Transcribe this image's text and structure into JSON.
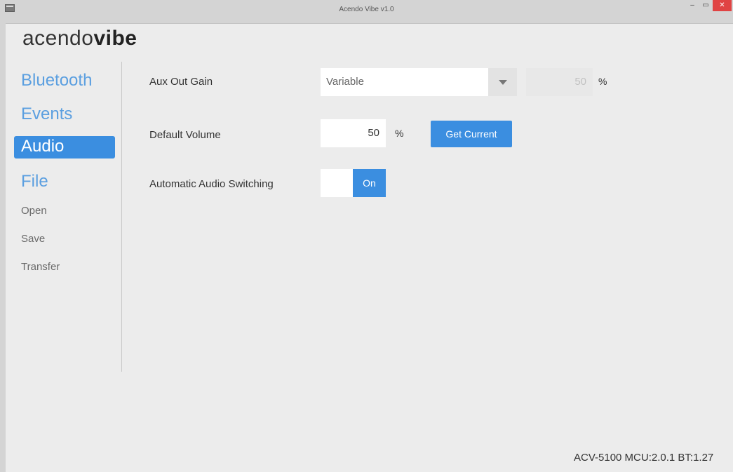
{
  "window": {
    "title": "Acendo Vibe v1.0",
    "minimize_glyph": "–",
    "maximize_glyph": "▭",
    "close_glyph": "✕"
  },
  "logo": {
    "light": "acendo",
    "bold": "vibe"
  },
  "sidebar": {
    "items": [
      {
        "label": "Bluetooth",
        "active": false
      },
      {
        "label": "Events",
        "active": false
      },
      {
        "label": "Audio",
        "active": true
      },
      {
        "label": "File",
        "active": false
      }
    ],
    "file_actions": [
      "Open",
      "Save",
      "Transfer"
    ]
  },
  "audio": {
    "aux_out_gain": {
      "label": "Aux Out Gain",
      "mode": "Variable",
      "value": "50",
      "unit": "%"
    },
    "default_volume": {
      "label": "Default Volume",
      "value": "50",
      "unit": "%",
      "get_current_label": "Get Current"
    },
    "auto_switching": {
      "label": "Automatic Audio Switching",
      "state": "On"
    }
  },
  "status_bar": "ACV-5100 MCU:2.0.1  BT:1.27",
  "colors": {
    "accent": "#3b8ee0",
    "nav_text": "#5b9fe0",
    "background": "#ececec",
    "close_button": "#e04343"
  },
  "icons": {
    "app": "app-window-icon",
    "dropdown": "chevron-down-icon"
  }
}
